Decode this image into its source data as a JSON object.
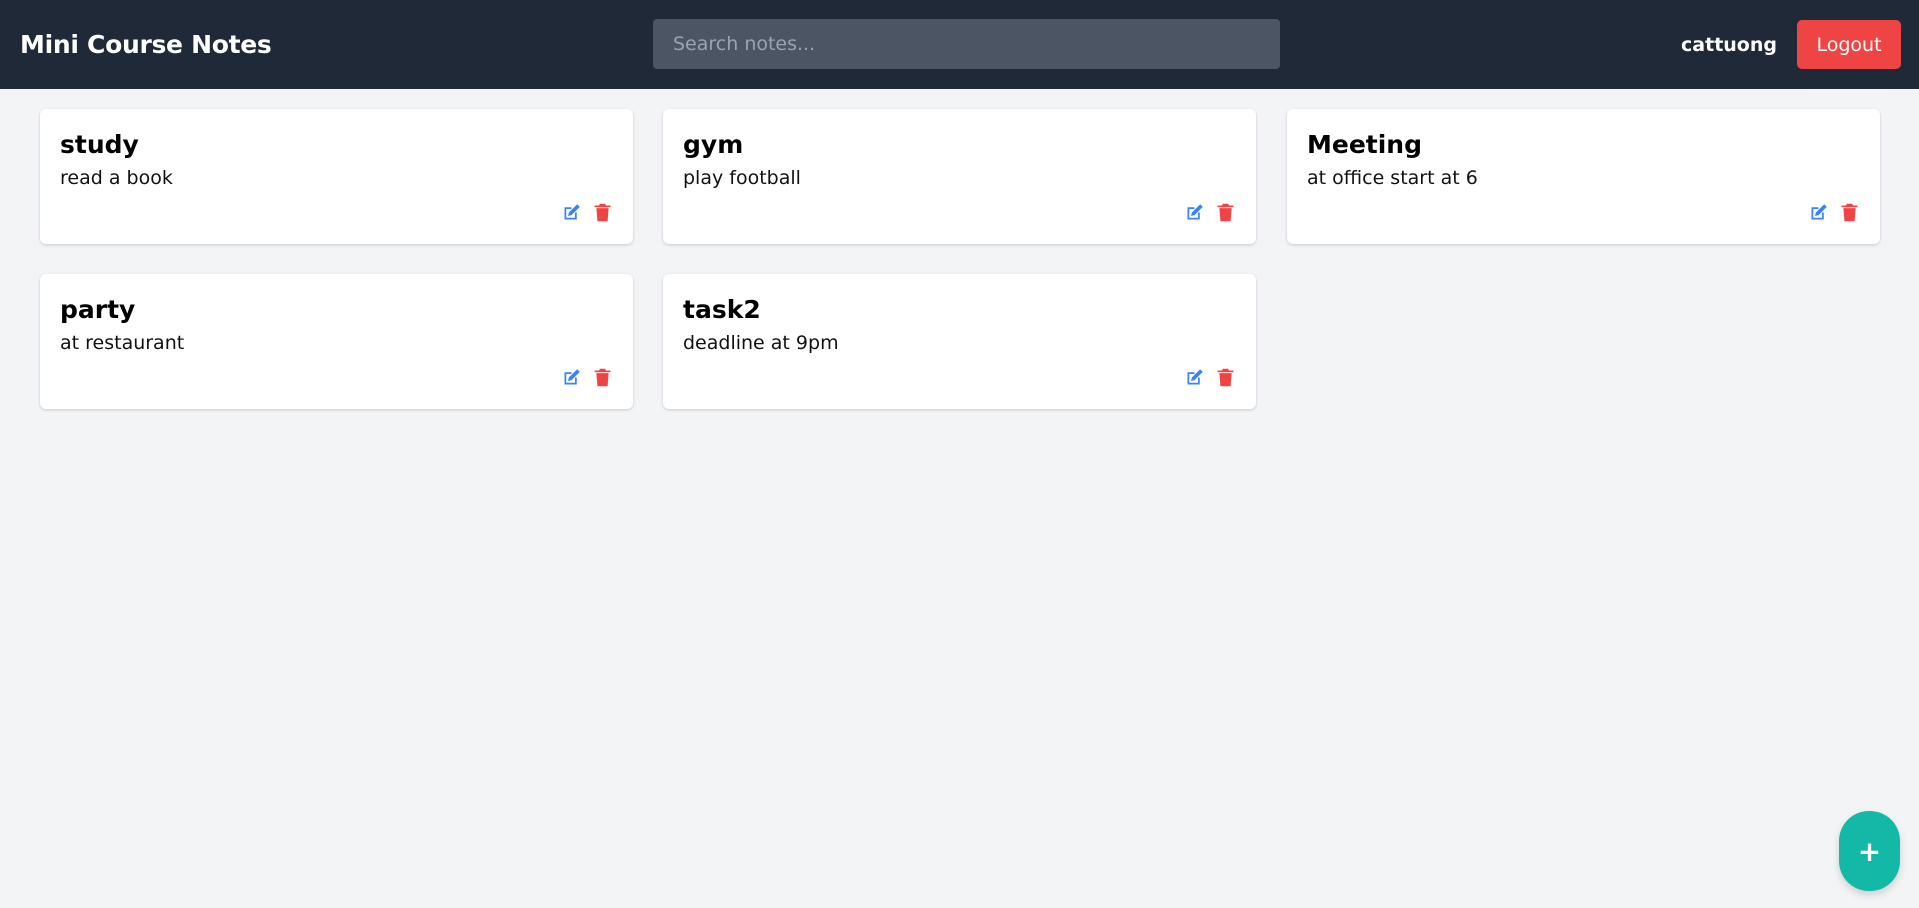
{
  "header": {
    "brand": "Mini Course Notes",
    "search_placeholder": "Search notes...",
    "search_value": "",
    "username": "cattuong",
    "logout_label": "Logout"
  },
  "notes": [
    {
      "title": "study",
      "body": "read a book"
    },
    {
      "title": "gym",
      "body": "play football"
    },
    {
      "title": "Meeting",
      "body": "at office start at 6"
    },
    {
      "title": "party",
      "body": "at restaurant"
    },
    {
      "title": "task2",
      "body": "deadline at 9pm"
    }
  ],
  "icons": {
    "edit": "edit-icon",
    "delete": "trash-icon",
    "add": "plus-icon"
  },
  "fab": {
    "label": "+"
  },
  "colors": {
    "navbar": "#1f2937",
    "search_bg": "#4b5563",
    "logout": "#ef4444",
    "edit_icon": "#3b82f6",
    "delete_icon": "#ef4444",
    "fab": "#14b8a6",
    "background": "#f3f4f6"
  }
}
